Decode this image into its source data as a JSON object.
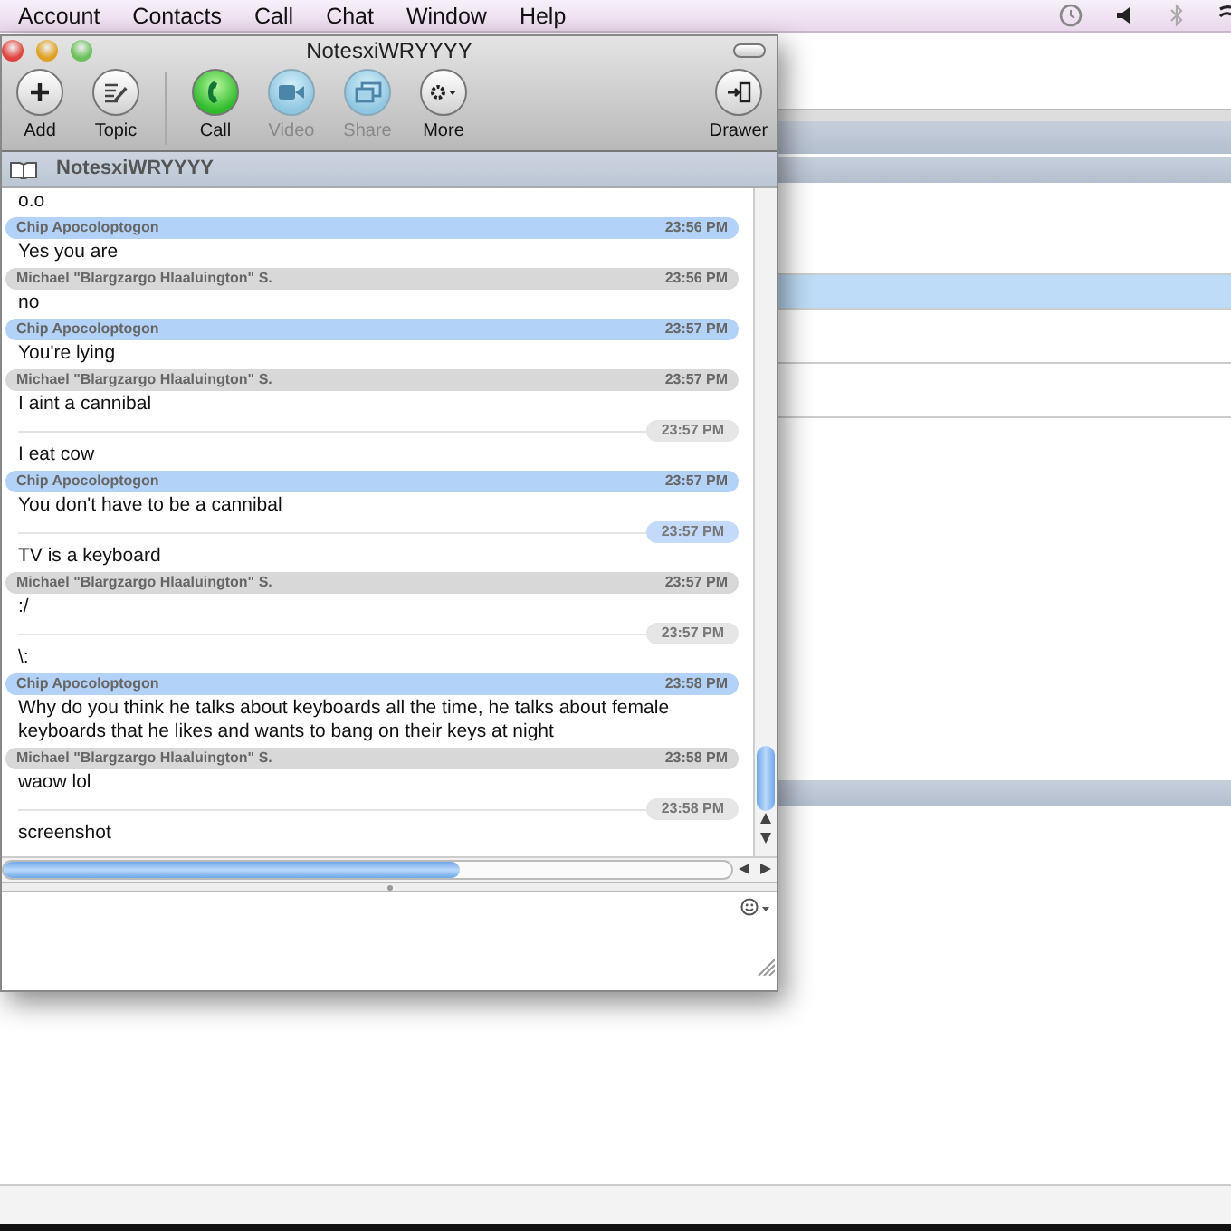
{
  "menu_bar": {
    "items": [
      "Account",
      "Contacts",
      "Call",
      "Chat",
      "Window",
      "Help"
    ]
  },
  "chat_window": {
    "title": "NotesxiWRYYYY",
    "toolbar": [
      {
        "kind": "add",
        "label": "Add",
        "disabled": false
      },
      {
        "kind": "topic",
        "label": "Topic",
        "disabled": false
      },
      {
        "kind": "call",
        "label": "Call",
        "disabled": false
      },
      {
        "kind": "video",
        "label": "Video",
        "disabled": true
      },
      {
        "kind": "share",
        "label": "Share",
        "disabled": true
      },
      {
        "kind": "more",
        "label": "More",
        "disabled": false
      },
      {
        "kind": "drawer",
        "label": "Drawer",
        "disabled": false
      }
    ],
    "room_title": "NotesxiWRYYYY",
    "messages": [
      {
        "kind": "text",
        "text": "o.o"
      },
      {
        "kind": "header",
        "sender": "Chip Apocoloptogon",
        "time": "23:56 PM",
        "mine": true,
        "text": "Yes you are"
      },
      {
        "kind": "header",
        "sender": "Michael \"Blargzargo Hlaaluington\" S.",
        "time": "23:56 PM",
        "mine": false,
        "text": "no"
      },
      {
        "kind": "header",
        "sender": "Chip Apocoloptogon",
        "time": "23:57 PM",
        "mine": true,
        "text": "You're lying"
      },
      {
        "kind": "header",
        "sender": "Michael \"Blargzargo Hlaaluington\" S.",
        "time": "23:57 PM",
        "mine": false,
        "text": "I aint a cannibal"
      },
      {
        "kind": "continued",
        "time": "23:57 PM",
        "mine": false,
        "text": "I eat cow"
      },
      {
        "kind": "header",
        "sender": "Chip Apocoloptogon",
        "time": "23:57 PM",
        "mine": true,
        "text": "You don't have to be a cannibal"
      },
      {
        "kind": "continued",
        "time": "23:57 PM",
        "mine": true,
        "text": "TV is a keyboard"
      },
      {
        "kind": "header",
        "sender": "Michael \"Blargzargo Hlaaluington\" S.",
        "time": "23:57 PM",
        "mine": false,
        "text": ":/"
      },
      {
        "kind": "continued",
        "time": "23:57 PM",
        "mine": false,
        "text": "\\:"
      },
      {
        "kind": "header",
        "sender": "Chip Apocoloptogon",
        "time": "23:58 PM",
        "mine": true,
        "text": "Why do you think he talks about keyboards all the time, he talks about female keyboards that he likes and wants to bang on their keys at night"
      },
      {
        "kind": "header",
        "sender": "Michael \"Blargzargo Hlaaluington\" S.",
        "time": "23:58 PM",
        "mine": false,
        "text": "waow lol"
      },
      {
        "kind": "continued",
        "time": "23:58 PM",
        "mine": false,
        "text": "screenshot"
      }
    ]
  }
}
